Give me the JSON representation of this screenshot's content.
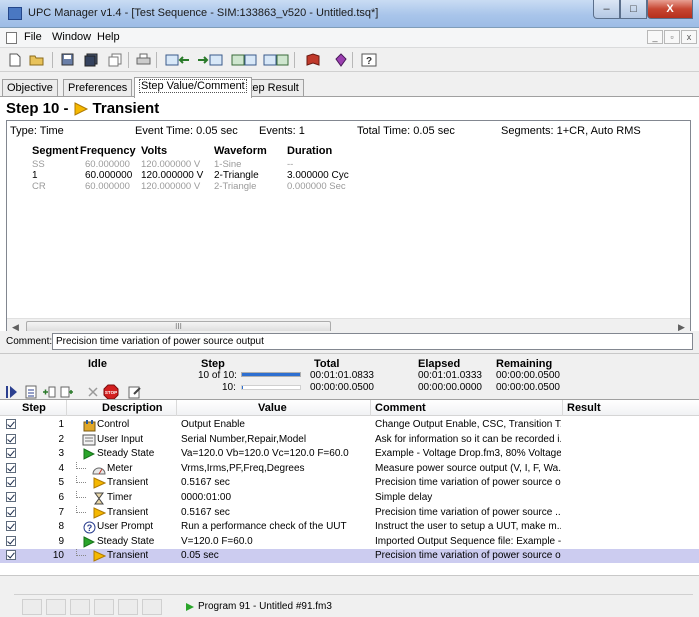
{
  "window": {
    "title": "UPC Manager v1.4 - [Test Sequence - SIM:133863_v520 - Untitled.tsq*]",
    "controls": {
      "minimize": "–",
      "maximize": "□",
      "close": "X"
    }
  },
  "menu": {
    "items": [
      "File",
      "Window",
      "Help"
    ],
    "mdi": {
      "minimize": "_",
      "restore": "▫",
      "close": "x"
    }
  },
  "toolbar": {
    "icons": [
      "new-file-icon",
      "open-folder-icon",
      "save-icon",
      "save-all-icon",
      "copy-icon",
      "print-icon",
      "import-sequence-icon",
      "export-sequence-icon",
      "upload-sequence-icon",
      "download-sequence-icon",
      "book-icon",
      "gem-icon",
      "help-icon"
    ]
  },
  "tabs": [
    "Objective",
    "Preferences",
    "Step Value/Comment",
    "Step Result"
  ],
  "step": {
    "title": "Step 10 -",
    "name": "Transient",
    "type": "Type: Time",
    "event_time": "Event Time: 0.05 sec",
    "events": "Events: 1",
    "total_time": "Total Time: 0.05 sec",
    "segments": "Segments: 1+CR, Auto RMS",
    "columns": [
      "Segment",
      "Frequency",
      "Volts",
      "Waveform",
      "Duration"
    ],
    "rows": [
      {
        "segment": "SS",
        "frequency": "60.000000",
        "volts": "120.000000 V",
        "waveform": "1-Sine",
        "duration": "--"
      },
      {
        "segment": "1",
        "frequency": "60.000000",
        "volts": "120.000000 V",
        "waveform": "2-Triangle",
        "duration": "3.000000 Cyc"
      },
      {
        "segment": "CR",
        "frequency": "60.000000",
        "volts": "120.000000 V",
        "waveform": "2-Triangle",
        "duration": "0.000000 Sec"
      }
    ],
    "scroll_thumb": "III"
  },
  "comment": {
    "label": "Comment:",
    "value": "Precision time variation of power source output"
  },
  "status": {
    "state": "Idle",
    "step_label": "Step",
    "step_of": "10 of 10:",
    "step_current": "10:",
    "total_label": "Total",
    "total_1": "00:01:01.0833",
    "total_2": "00:00:00.0500",
    "elapsed_label": "Elapsed",
    "elapsed_1": "00:01:01.0333",
    "elapsed_2": "00:00:00.0000",
    "remaining_label": "Remaining",
    "remaining_1": "00:00:00.0500",
    "remaining_2": "00:00:00.0500",
    "step_progress_fraction": 1.0,
    "current_progress_fraction": 0.02,
    "stop_label": "STOP"
  },
  "sequence": {
    "headers": {
      "step": "Step",
      "description": "Description",
      "value": "Value",
      "comment": "Comment",
      "result": "Result"
    },
    "rows": [
      {
        "step": "1",
        "icon": "control-icon",
        "description": "Control",
        "value": "Output Enable",
        "comment": "Change Output Enable, CSC, Transition T...",
        "indent": 0,
        "selected": false
      },
      {
        "step": "2",
        "icon": "user-input-icon",
        "description": "User Input",
        "value": "Serial Number,Repair,Model",
        "comment": "Ask for information so it can be recorded i...",
        "indent": 0,
        "selected": false
      },
      {
        "step": "3",
        "icon": "steady-state-icon",
        "description": "Steady State",
        "value": "Va=120.0 Vb=120.0 Vc=120.0 F=60.0",
        "comment": "Example - Voltage Drop.fm3, 80% Voltage...",
        "indent": 0,
        "selected": false
      },
      {
        "step": "4",
        "icon": "meter-icon",
        "description": "Meter",
        "value": "Vrms,Irms,PF,Freq,Degrees",
        "comment": "Measure power source output (V, I, F, Wa...",
        "indent": 1,
        "selected": false
      },
      {
        "step": "5",
        "icon": "transient-icon",
        "description": "Transient",
        "value": "0.5167 sec",
        "comment": "Precision time variation of power source o...",
        "indent": 1,
        "selected": false
      },
      {
        "step": "6",
        "icon": "timer-icon",
        "description": "Timer",
        "value": "0000:01:00",
        "comment": "Simple delay",
        "indent": 1,
        "selected": false
      },
      {
        "step": "7",
        "icon": "transient-icon",
        "description": "Transient",
        "value": "0.5167 sec",
        "comment": "Precision time variation of power source  ...",
        "indent": 1,
        "selected": false
      },
      {
        "step": "8",
        "icon": "user-prompt-icon",
        "description": "User Prompt",
        "value": "Run a performance check of the UUT",
        "comment": "Instruct the user to setup a UUT, make m...",
        "indent": 0,
        "selected": false
      },
      {
        "step": "9",
        "icon": "steady-state-icon",
        "description": "Steady State",
        "value": "V=120.0 F=60.0",
        "comment": "Imported Output Sequence file: Example -...",
        "indent": 0,
        "selected": false
      },
      {
        "step": "10",
        "icon": "transient-icon",
        "description": "Transient",
        "value": "0.05 sec",
        "comment": "Precision time variation of power source o...",
        "indent": 1,
        "selected": true
      }
    ]
  },
  "statusbar": {
    "program": "Program 91 - Untitled #91.fm3"
  },
  "colors": {
    "selection": "#ccccf0",
    "progress": "#2e6fd0",
    "play_green": "#2aa52a",
    "transient_orange": "#f5b800"
  }
}
